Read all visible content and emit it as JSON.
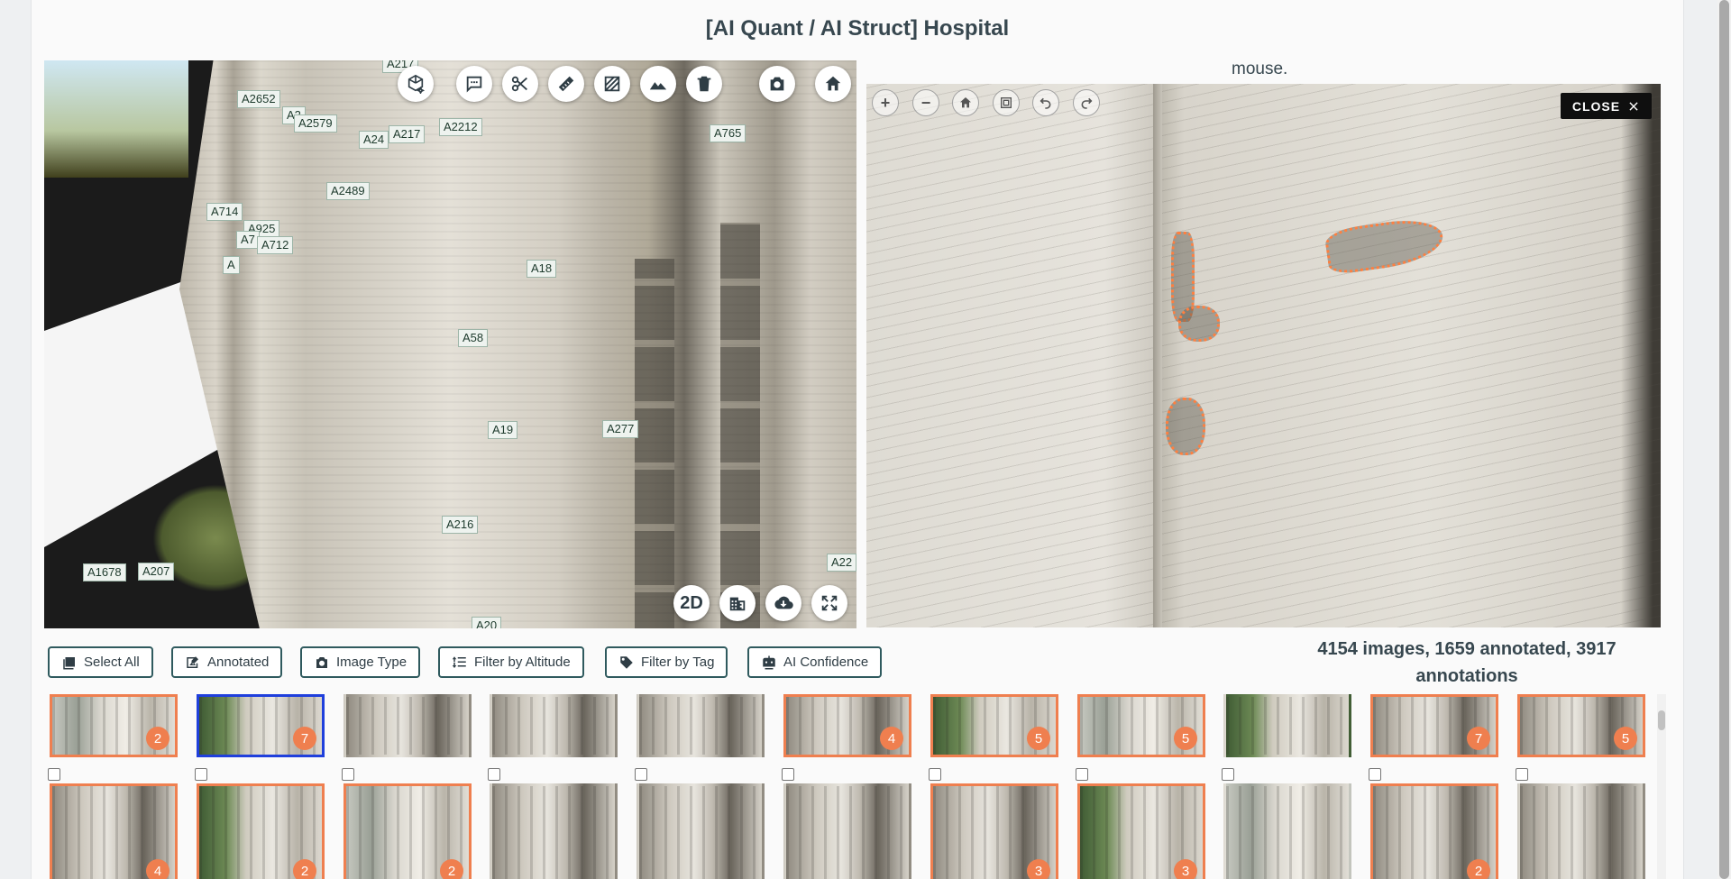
{
  "page": {
    "title": "[AI Quant / AI Struct] Hospital",
    "viewer_hint": "mouse."
  },
  "viewer3d": {
    "labels": [
      "A217",
      "A2652",
      "A2",
      "A2579",
      "A24",
      "A217",
      "A2212",
      "A765",
      "A2489",
      "A714",
      "A925",
      "A7",
      "A712",
      "A",
      "A18",
      "A58",
      "A19",
      "A277",
      "A216",
      "A1678",
      "A207",
      "A22",
      "A20"
    ],
    "toolbar": [
      {
        "name": "model-3d-icon"
      },
      {
        "name": "comment-icon"
      },
      {
        "name": "scissors-icon"
      },
      {
        "name": "ruler-icon"
      },
      {
        "name": "area-hatch-icon"
      },
      {
        "name": "terrain-icon"
      },
      {
        "name": "trash-icon"
      },
      {
        "name": "camera-icon"
      },
      {
        "name": "home-icon"
      }
    ],
    "bottom_toolbar": {
      "mode_label": "2D",
      "icons": [
        "building-icon",
        "cloud-download-icon",
        "fullscreen-icon"
      ]
    }
  },
  "viewer2d": {
    "controls": [
      "zoom-in-icon",
      "zoom-out-icon",
      "home-icon",
      "fit-screen-icon",
      "rotate-left-icon",
      "rotate-right-icon"
    ],
    "close_label": "CLOSE",
    "colors": {
      "annotation": "#ff7f3f"
    }
  },
  "filters": {
    "select_all": "Select All",
    "annotated": "Annotated",
    "image_type": "Image Type",
    "filter_altitude": "Filter by Altitude",
    "filter_tag": "Filter by Tag",
    "ai_confidence": "AI Confidence"
  },
  "summary": {
    "line1": "4154 images, 1659 annotated, 3917",
    "line2": "annotations"
  },
  "thumbnails": {
    "row1": [
      {
        "count": "2",
        "annotated": true,
        "selected": false,
        "style": "city"
      },
      {
        "count": "7",
        "annotated": false,
        "selected": true,
        "style": "tree"
      },
      {
        "count": "",
        "annotated": false,
        "selected": false,
        "style": "plain"
      },
      {
        "count": "",
        "annotated": false,
        "selected": false,
        "style": "plain"
      },
      {
        "count": "",
        "annotated": false,
        "selected": false,
        "style": "plain"
      },
      {
        "count": "4",
        "annotated": true,
        "selected": false,
        "style": "plain"
      },
      {
        "count": "5",
        "annotated": true,
        "selected": false,
        "style": "tree"
      },
      {
        "count": "5",
        "annotated": true,
        "selected": false,
        "style": "city"
      },
      {
        "count": "",
        "annotated": false,
        "selected": false,
        "style": "tree"
      },
      {
        "count": "7",
        "annotated": true,
        "selected": false,
        "style": "plain"
      },
      {
        "count": "5",
        "annotated": true,
        "selected": false,
        "style": "plain"
      }
    ],
    "row2": [
      {
        "count": "4",
        "annotated": true,
        "style": "plain"
      },
      {
        "count": "2",
        "annotated": true,
        "style": "tree"
      },
      {
        "count": "2",
        "annotated": true,
        "style": "city"
      },
      {
        "count": "",
        "annotated": false,
        "style": "plain"
      },
      {
        "count": "",
        "annotated": false,
        "style": "plain"
      },
      {
        "count": "",
        "annotated": false,
        "style": "plain"
      },
      {
        "count": "3",
        "annotated": true,
        "style": "plain"
      },
      {
        "count": "3",
        "annotated": true,
        "style": "tree"
      },
      {
        "count": "",
        "annotated": false,
        "style": "city"
      },
      {
        "count": "2",
        "annotated": true,
        "style": "plain"
      },
      {
        "count": "",
        "annotated": false,
        "style": "plain"
      }
    ]
  }
}
